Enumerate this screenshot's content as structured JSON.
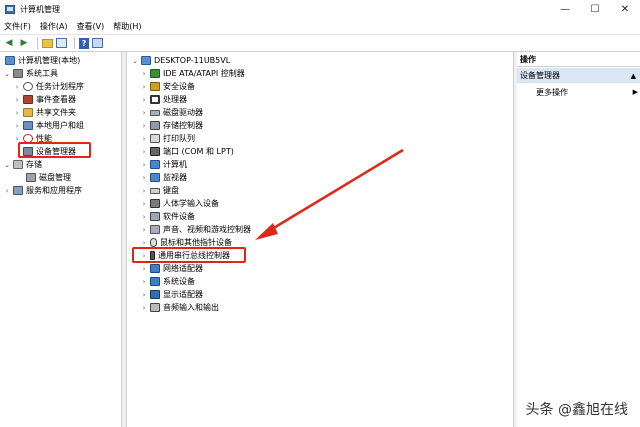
{
  "window": {
    "title": "计算机管理",
    "minimize": "—",
    "maximize": "☐",
    "close": "✕"
  },
  "menu": [
    "文件(F)",
    "操作(A)",
    "查看(V)",
    "帮助(H)"
  ],
  "toolbar": {
    "back": "◀",
    "forward": "▶",
    "help": "?"
  },
  "left_tree": {
    "root": "计算机管理(本地)",
    "system_tools": "系统工具",
    "task_scheduler": "任务计划程序",
    "event_viewer": "事件查看器",
    "shared_folders": "共享文件夹",
    "local_users": "本地用户和组",
    "performance": "性能",
    "device_manager": "设备管理器",
    "storage": "存储",
    "disk_management": "磁盘管理",
    "services": "服务和应用程序"
  },
  "device_tree": {
    "root": "DESKTOP-11UB5VL",
    "items": [
      "IDE ATA/ATAPI 控制器",
      "安全设备",
      "处理器",
      "磁盘驱动器",
      "存储控制器",
      "打印队列",
      "端口 (COM 和 LPT)",
      "计算机",
      "监视器",
      "键盘",
      "人体学输入设备",
      "软件设备",
      "声音、视频和游戏控制器",
      "鼠标和其他指针设备",
      "通用串行总线控制器",
      "网络适配器",
      "系统设备",
      "显示适配器",
      "音频输入和输出"
    ]
  },
  "actions": {
    "header": "操作",
    "section": "设备管理器",
    "more": "更多操作"
  },
  "watermark": "头条 @鑫旭在线",
  "colors": {
    "highlight_red": "#e0261b",
    "selection_blue": "#d9e6f4"
  }
}
